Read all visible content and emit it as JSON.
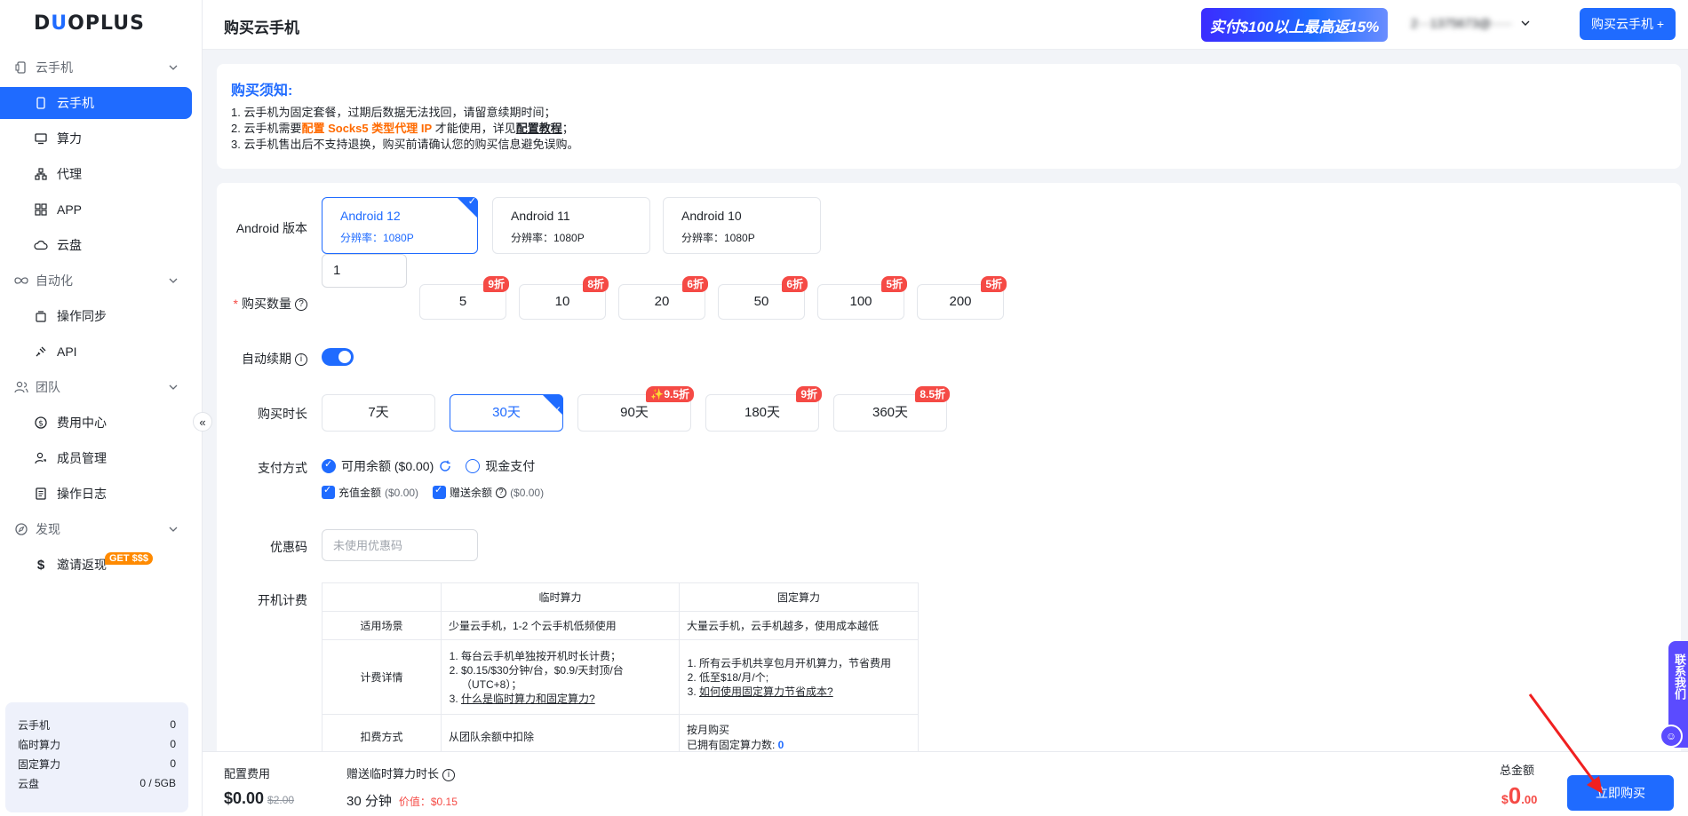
{
  "brand": {
    "logo_pre": "D",
    "logo_o": "U",
    "logo_rest": "OPLUS"
  },
  "sidebar": {
    "groups": [
      {
        "label": "云手机",
        "icon": "phone-icon"
      },
      {
        "label": "自动化",
        "icon": "infinity-icon"
      },
      {
        "label": "团队",
        "icon": "team-icon"
      },
      {
        "label": "发现",
        "icon": "compass-icon"
      }
    ],
    "items": {
      "cloud_phone": "云手机",
      "compute": "算力",
      "proxy": "代理",
      "app": "APP",
      "cloud_disk": "云盘",
      "sync": "操作同步",
      "api": "API",
      "billing": "费用中心",
      "members": "成员管理",
      "logs": "操作日志",
      "invite": "邀请返现"
    },
    "invite_badge": "GET $$$",
    "stats": [
      {
        "label": "云手机",
        "value": "0"
      },
      {
        "label": "临时算力",
        "value": "0"
      },
      {
        "label": "固定算力",
        "value": "0"
      },
      {
        "label": "云盘",
        "value": "0 / 5GB"
      }
    ]
  },
  "header": {
    "title": "购买云手机",
    "promo": "实付$100以上最高返15%",
    "user": "2···1375673@·····",
    "buy_button": "购买云手机 +"
  },
  "notice": {
    "title": "购买须知:",
    "line1": "1. 云手机为固定套餐，过期后数据无法找回，请留意续期时间；",
    "line2_pre": "2. 云手机需要",
    "line2_orange": "配置 Socks5 类型代理 IP",
    "line2_mid": " 才能使用，详见",
    "line2_link": "配置教程",
    "line2_post": "；",
    "line3": "3. 云手机售出后不支持退换，购买前请确认您的购买信息避免误购。"
  },
  "form": {
    "android_label": "Android 版本",
    "versions": [
      {
        "name": "Android 12",
        "res": "分辨率：1080P"
      },
      {
        "name": "Android 11",
        "res": "分辨率：1080P"
      },
      {
        "name": "Android 10",
        "res": "分辨率：1080P"
      }
    ],
    "qty_label": "购买数量",
    "qty_value": "1",
    "qty_options": [
      {
        "value": "5",
        "disc": "9折"
      },
      {
        "value": "10",
        "disc": "8折"
      },
      {
        "value": "20",
        "disc": "6折"
      },
      {
        "value": "50",
        "disc": "6折"
      },
      {
        "value": "100",
        "disc": "5折"
      },
      {
        "value": "200",
        "disc": "5折"
      }
    ],
    "auto_renew_label": "自动续期",
    "duration_label": "购买时长",
    "durations": [
      {
        "value": "7天",
        "disc": ""
      },
      {
        "value": "30天",
        "disc": ""
      },
      {
        "value": "90天",
        "disc": "✨9.5折"
      },
      {
        "value": "180天",
        "disc": "9折"
      },
      {
        "value": "360天",
        "disc": "8.5折"
      }
    ],
    "pay_label": "支付方式",
    "pay_balance": "可用余额 ($0.00)",
    "pay_cash": "现金支付",
    "recharge": "充值金额",
    "recharge_amt": "($0.00)",
    "gift": "赠送余额",
    "gift_amt": "($0.00)",
    "coupon_label": "优惠码",
    "coupon_placeholder": "未使用优惠码",
    "boot_label": "开机计费",
    "table": {
      "head_temp": "临时算力",
      "head_fixed": "固定算力",
      "row1_label": "适用场景",
      "row1_temp": "少量云手机，1-2 个云手机低频使用",
      "row1_fixed": "大量云手机，云手机越多，使用成本越低",
      "row2_label": "计费详情",
      "row2_temp_1": "每台云手机单独按开机时长计费；",
      "row2_temp_2": "$0.15/$30分钟/台，$0.9/天封顶/台（UTC+8）；",
      "row2_temp_3": "什么是临时算力和固定算力?",
      "row2_fixed_1": "所有云手机共享包月开机算力，节省费用",
      "row2_fixed_2": "低至$18/月/个;",
      "row2_fixed_3": "如何使用固定算力节省成本?",
      "row3_label": "扣费方式",
      "row3_temp": "从团队余额中扣除",
      "row3_fixed_1": "按月购买",
      "row3_fixed_2": "已拥有固定算力数: ",
      "row3_fixed_num": "0"
    }
  },
  "bottom": {
    "config_label": "配置费用",
    "config_value": "$0.00",
    "config_original": "$2.00",
    "gift_label": "赠送临时算力时长",
    "gift_value": "30 分钟",
    "gift_worth": "价值：$0.15",
    "total_label": "总金额",
    "total_cur": "$",
    "total_int": "0",
    "total_dec": ".00",
    "buy_now": "立即购买"
  },
  "contact": "联系我们",
  "colors": {
    "primary": "#1f6bff",
    "danger": "#f54a45",
    "orange": "#ff6a00"
  }
}
